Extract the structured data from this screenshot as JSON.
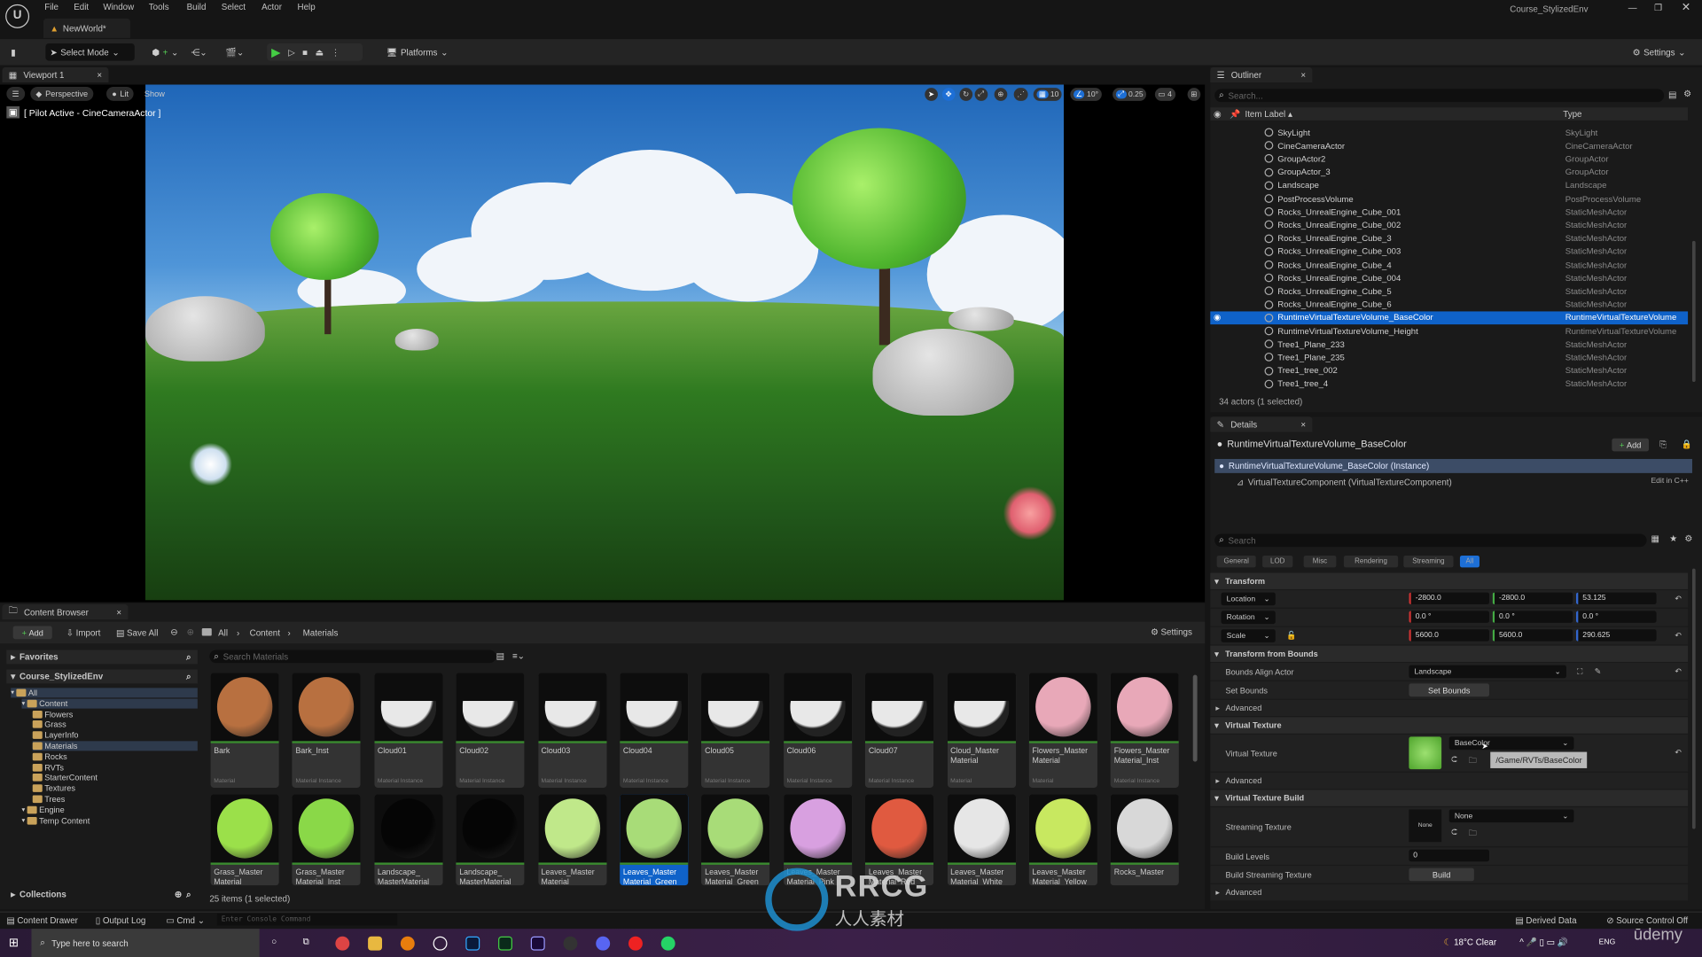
{
  "app": {
    "project_name": "Course_StylizedEnv",
    "document_tab": "NewWorld*",
    "menu": [
      "File",
      "Edit",
      "Window",
      "Tools",
      "Build",
      "Select",
      "Actor",
      "Help"
    ]
  },
  "toolbar": {
    "select_mode": "Select Mode",
    "platforms": "Platforms",
    "settings": "Settings"
  },
  "viewport": {
    "tab": "Viewport 1",
    "perspective": "Perspective",
    "lit": "Lit",
    "show": "Show",
    "pilot": "[ Pilot Active - CineCameraActor ]",
    "grid_snap": "10",
    "rotation_snap": "10°",
    "scale_snap": "0.25",
    "camera_speed": "4"
  },
  "outliner": {
    "tab": "Outliner",
    "search_placeholder": "Search...",
    "col_label": "Item Label",
    "col_type": "Type",
    "status": "34 actors (1 selected)",
    "items": [
      {
        "label": "SkyLight",
        "type": "SkyLight"
      },
      {
        "label": "CineCameraActor",
        "type": "CineCameraActor"
      },
      {
        "label": "GroupActor2",
        "type": "GroupActor"
      },
      {
        "label": "GroupActor_3",
        "type": "GroupActor"
      },
      {
        "label": "Landscape",
        "type": "Landscape"
      },
      {
        "label": "PostProcessVolume",
        "type": "PostProcessVolume"
      },
      {
        "label": "Rocks_UnrealEngine_Cube_001",
        "type": "StaticMeshActor"
      },
      {
        "label": "Rocks_UnrealEngine_Cube_002",
        "type": "StaticMeshActor"
      },
      {
        "label": "Rocks_UnrealEngine_Cube_3",
        "type": "StaticMeshActor"
      },
      {
        "label": "Rocks_UnrealEngine_Cube_003",
        "type": "StaticMeshActor"
      },
      {
        "label": "Rocks_UnrealEngine_Cube_4",
        "type": "StaticMeshActor"
      },
      {
        "label": "Rocks_UnrealEngine_Cube_004",
        "type": "StaticMeshActor"
      },
      {
        "label": "Rocks_UnrealEngine_Cube_5",
        "type": "StaticMeshActor"
      },
      {
        "label": "Rocks_UnrealEngine_Cube_6",
        "type": "StaticMeshActor"
      },
      {
        "label": "RuntimeVirtualTextureVolume_BaseColor",
        "type": "RuntimeVirtualTextureVolume",
        "selected": true
      },
      {
        "label": "RuntimeVirtualTextureVolume_Height",
        "type": "RuntimeVirtualTextureVolume"
      },
      {
        "label": "Tree1_Plane_233",
        "type": "StaticMeshActor"
      },
      {
        "label": "Tree1_Plane_235",
        "type": "StaticMeshActor"
      },
      {
        "label": "Tree1_tree_002",
        "type": "StaticMeshActor"
      },
      {
        "label": "Tree1_tree_4",
        "type": "StaticMeshActor"
      }
    ]
  },
  "details": {
    "tab": "Details",
    "actor_name": "RuntimeVirtualTextureVolume_BaseColor",
    "add": "Add",
    "instance": "RuntimeVirtualTextureVolume_BaseColor (Instance)",
    "component": "VirtualTextureComponent (VirtualTextureComponent)",
    "edit_cpp": "Edit in C++",
    "search_placeholder": "Search",
    "filters": [
      "General",
      "LOD",
      "Misc",
      "Rendering",
      "Streaming",
      "All"
    ],
    "transform": {
      "title": "Transform",
      "location_label": "Location",
      "rotation_label": "Rotation",
      "scale_label": "Scale",
      "location": [
        "-2800.0",
        "-2800.0",
        "53.125"
      ],
      "rotation": [
        "0.0 °",
        "0.0 °",
        "0.0 °"
      ],
      "scale": [
        "5600.0",
        "5600.0",
        "290.625"
      ]
    },
    "bounds": {
      "title": "Transform from Bounds",
      "align_label": "Bounds Align Actor",
      "align_value": "Landscape",
      "set_label": "Set Bounds",
      "set_button": "Set Bounds",
      "advanced": "Advanced"
    },
    "vt": {
      "title": "Virtual Texture",
      "label": "Virtual Texture",
      "value": "BaseColor",
      "tooltip": "/Game/RVTs/BaseColor",
      "advanced": "Advanced"
    },
    "vtb": {
      "title": "Virtual Texture Build",
      "streaming_label": "Streaming Texture",
      "streaming_value": "None",
      "thumb_none": "None",
      "levels_label": "Build Levels",
      "levels_value": "0",
      "build_label": "Build Streaming Texture",
      "build_button": "Build",
      "advanced": "Advanced"
    }
  },
  "content_browser": {
    "tab": "Content Browser",
    "add": "Add",
    "import": "Import",
    "save_all": "Save All",
    "breadcrumb": [
      "All",
      "Content",
      "Materials"
    ],
    "settings": "Settings",
    "favorites": "Favorites",
    "project": "Course_StylizedEnv",
    "search_placeholder": "Search Materials",
    "status": "25 items (1 selected)",
    "tree": [
      {
        "label": "All",
        "depth": 0
      },
      {
        "label": "Content",
        "depth": 1
      },
      {
        "label": "Flowers",
        "depth": 2
      },
      {
        "label": "Grass",
        "depth": 2
      },
      {
        "label": "LayerInfo",
        "depth": 2
      },
      {
        "label": "Materials",
        "depth": 2,
        "selected": true
      },
      {
        "label": "Rocks",
        "depth": 2
      },
      {
        "label": "RVTs",
        "depth": 2
      },
      {
        "label": "StarterContent",
        "depth": 2
      },
      {
        "label": "Textures",
        "depth": 2
      },
      {
        "label": "Trees",
        "depth": 2
      },
      {
        "label": "Engine",
        "depth": 1
      },
      {
        "label": "Temp Content",
        "depth": 1
      }
    ],
    "assets": [
      {
        "name": "Bark",
        "type": "Material",
        "color": "#b87040"
      },
      {
        "name": "Bark_Inst",
        "type": "Material Instance",
        "color": "#b87040"
      },
      {
        "name": "Cloud01",
        "type": "Material Instance",
        "color": "#e8e8e8"
      },
      {
        "name": "Cloud02",
        "type": "Material Instance",
        "color": "#e8e8e8"
      },
      {
        "name": "Cloud03",
        "type": "Material Instance",
        "color": "#e8e8e8"
      },
      {
        "name": "Cloud04",
        "type": "Material Instance",
        "color": "#e8e8e8"
      },
      {
        "name": "Cloud05",
        "type": "Material Instance",
        "color": "#e8e8e8"
      },
      {
        "name": "Cloud06",
        "type": "Material Instance",
        "color": "#e8e8e8"
      },
      {
        "name": "Cloud07",
        "type": "Material Instance",
        "color": "#e8e8e8"
      },
      {
        "name": "Cloud_Master Material",
        "type": "Material",
        "color": "#e8e8e8"
      },
      {
        "name": "Flowers_Master Material",
        "type": "Material",
        "color": "#e8a8b8"
      },
      {
        "name": "Flowers_Master Material_Inst",
        "type": "Material Instance",
        "color": "#e8a8b8"
      },
      {
        "name": "Grass_Master Material",
        "type": "",
        "color": "#9be04a"
      },
      {
        "name": "Grass_Master Material_Inst",
        "type": "",
        "color": "#8ad848"
      },
      {
        "name": "Landscape_ MasterMaterial",
        "type": "",
        "color": "#050505"
      },
      {
        "name": "Landscape_ MasterMaterial_",
        "type": "",
        "color": "#050505"
      },
      {
        "name": "Leaves_Master Material",
        "type": "",
        "color": "#c0e88a"
      },
      {
        "name": "Leaves_Master Material_Green",
        "type": "",
        "color": "#a8dc78",
        "selected": true
      },
      {
        "name": "Leaves_Master Material_Green_",
        "type": "",
        "color": "#a8dc78"
      },
      {
        "name": "Leaves_Master Material_Pink",
        "type": "",
        "color": "#d8a0e0"
      },
      {
        "name": "Leaves_Master Material_Red",
        "type": "",
        "color": "#e05a40"
      },
      {
        "name": "Leaves_Master Material_White",
        "type": "",
        "color": "#e6e6e6"
      },
      {
        "name": "Leaves_Master Material_Yellow",
        "type": "",
        "color": "#c8e860"
      },
      {
        "name": "Rocks_Master",
        "type": "",
        "color": "#d8d8d8"
      }
    ]
  },
  "statusbar": {
    "content_drawer": "Content Drawer",
    "output_log": "Output Log",
    "cmd": "Cmd",
    "console_placeholder": "Enter Console Command",
    "derived_data": "Derived Data",
    "source_control": "Source Control Off"
  },
  "taskbar": {
    "search_placeholder": "Type here to search",
    "weather": "18°C Clear",
    "lang": "ENG"
  },
  "watermark": {
    "text": "RRCG",
    "sub": "人人素材",
    "udemy": "ūdemy"
  }
}
